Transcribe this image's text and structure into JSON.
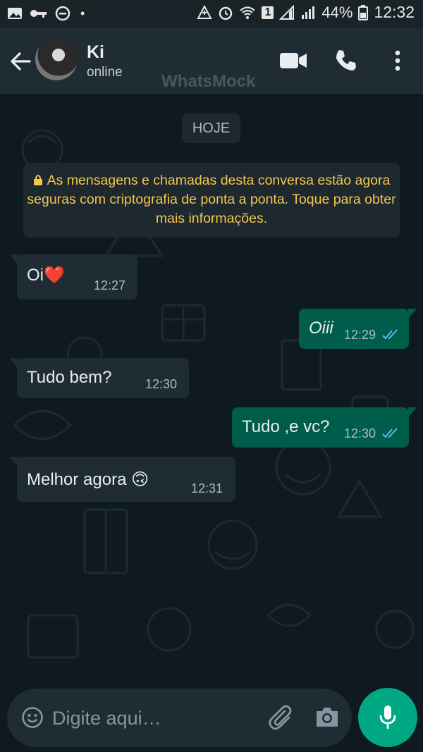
{
  "status_bar": {
    "battery_percent": "44%",
    "time": "12:32",
    "sim_badge": "1"
  },
  "header": {
    "contact_name": "Ki",
    "contact_status": "online",
    "watermark": "WhatsMock",
    "icons": [
      "back-arrow-icon",
      "video-call-icon",
      "phone-icon",
      "more-vert-icon"
    ]
  },
  "chat": {
    "date_label": "HOJE",
    "encryption_notice": "As mensagens e chamadas desta conversa estão agora seguras com criptografia de ponta a ponta. Toque para obter mais informações.",
    "messages": [
      {
        "direction": "in",
        "text": "Oi❤️",
        "time": "12:27"
      },
      {
        "direction": "out",
        "text": "Oiii",
        "time": "12:29",
        "status": "read"
      },
      {
        "direction": "in",
        "text": "Tudo bem?",
        "time": "12:30"
      },
      {
        "direction": "out",
        "text": "Tudo ,e vc?",
        "time": "12:30",
        "status": "read"
      },
      {
        "direction": "in",
        "text": "Melhor agora 🙃",
        "time": "12:31"
      }
    ]
  },
  "composer": {
    "placeholder": "Digite aqui…"
  },
  "colors": {
    "header": "#1f2c33",
    "incoming_bubble": "#1f2c33",
    "outgoing_bubble": "#005c4b",
    "accent": "#00a884",
    "read_ticks": "#53bdeb",
    "notice_text": "#f4c64a"
  }
}
